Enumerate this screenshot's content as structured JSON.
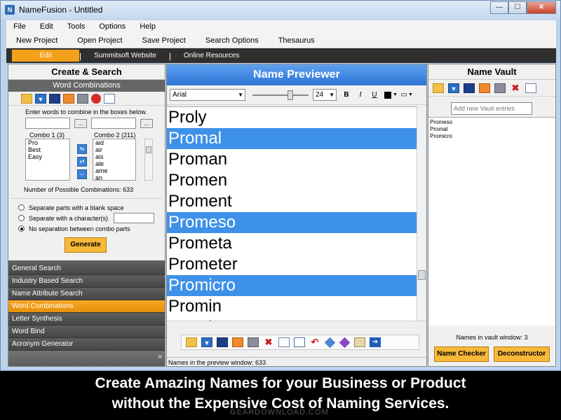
{
  "window": {
    "title": "NameFusion - Untitled",
    "btn_min": "—",
    "btn_max": "☐",
    "btn_close": "✕"
  },
  "menu": [
    "File",
    "Edit",
    "Tools",
    "Options",
    "Help"
  ],
  "toolbar": [
    "New Project",
    "Open Project",
    "Save Project",
    "Search Options",
    "Thesaurus"
  ],
  "nav": {
    "active": "Edit",
    "items": [
      "Summitsoft Website",
      "Online  Resources"
    ]
  },
  "left": {
    "title": "Create & Search",
    "subtitle": "Word Combinations",
    "instruction": "Enter words to combine in the boxes below.",
    "combo1_label": "Combo 1 (3)",
    "combo2_label": "Combo 2 (211)",
    "combo1_items": [
      "Pro",
      "Best",
      "Easy"
    ],
    "combo2_items": [
      "aid",
      "air",
      "ais",
      "ale",
      "ame",
      "an"
    ],
    "dots": "...",
    "possible": "Number of Possible Combinations: 633",
    "radio1": "Separate parts with a blank space",
    "radio2": "Separate with a character(s)",
    "radio3": "No separation between combo parts",
    "generate": "Generate",
    "categories": [
      "General Search",
      "Industry Based Search",
      "Name Attribute Search",
      "Word Combinations",
      "Letter Synthesis",
      "Word Bind",
      "Acronym Generator"
    ],
    "active_category": "Word Combinations",
    "more": "»"
  },
  "center": {
    "title": "Name Previewer",
    "font": "Arial",
    "size": "24",
    "bold": "B",
    "italic": "I",
    "underline": "U",
    "names": [
      "Proly",
      "Promal",
      "Proman",
      "Promen",
      "Proment",
      "Promeso",
      "Prometa",
      "Prometer",
      "Promicro",
      "Promin",
      "Promis"
    ],
    "selected": [
      "Promal",
      "Promeso",
      "Promicro"
    ],
    "status": "Names in the preview window: 633"
  },
  "right": {
    "title": "Name Vault",
    "placeholder": "Add new Vault entries",
    "vault": [
      "Promeso",
      "Promal",
      "Promicro"
    ],
    "count": "Names in vault window: 3",
    "name_checker": "Name Checker",
    "deconstructor": "Deconstructor"
  },
  "caption": {
    "line1": "Create Amazing Names for your Business or Product",
    "line2": "without the Expensive Cost of Naming Services."
  },
  "watermark": "GEARDOWNLOAD.COM",
  "colors": {
    "accent_orange": "#f4a11a",
    "header_blue": "#2c74d7",
    "selected_blue": "#3e91e8",
    "dark_nav": "#2f2f2f"
  },
  "icons": [
    "folder-icon",
    "download-icon",
    "save-icon",
    "export-icon",
    "print-icon",
    "delete-icon",
    "new-page-icon"
  ]
}
